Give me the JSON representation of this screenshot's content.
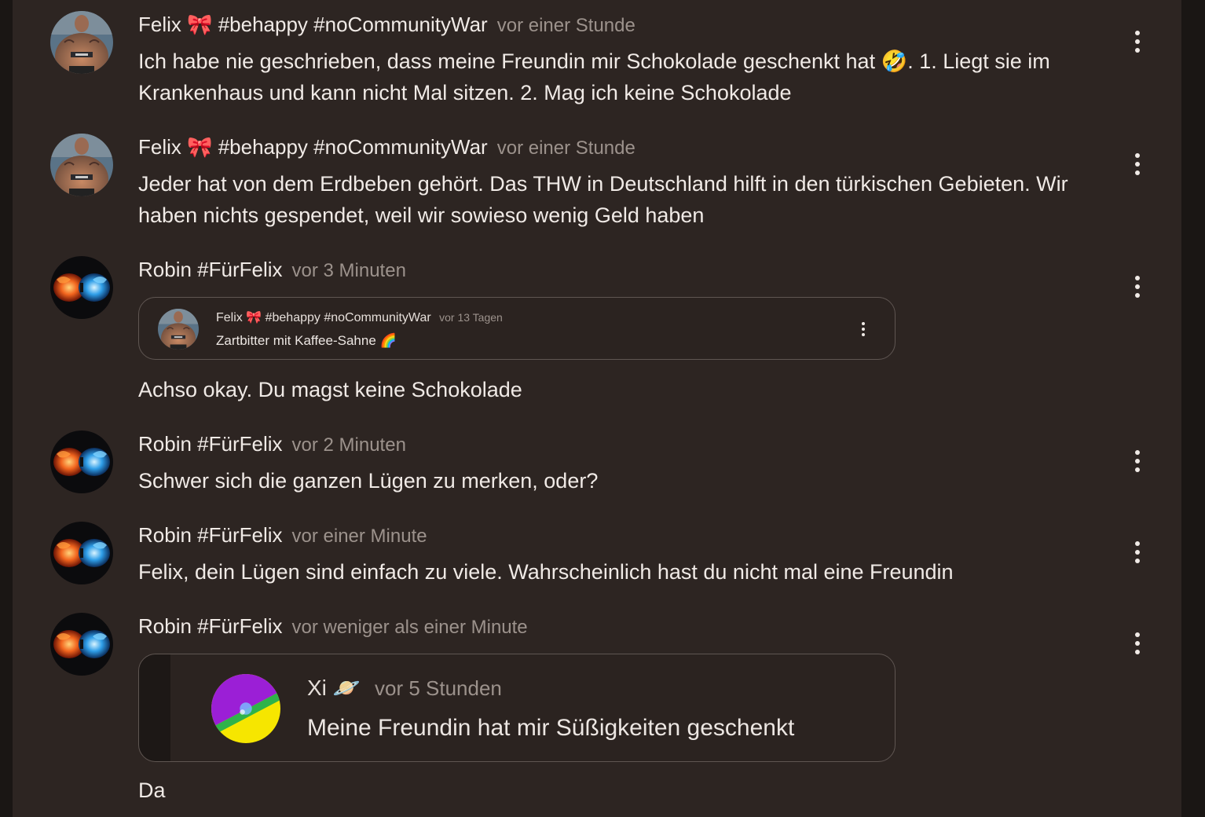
{
  "comments": [
    {
      "author": "Felix 🎀 #behappy #noCommunityWar",
      "time": "vor einer Stunde",
      "text_before": "Ich habe nie geschrieben, dass meine Freundin mir Schokolade geschenkt hat ",
      "text_emoji": "🤣",
      "text_after": ". 1. Liegt sie im Krankenhaus und kann nicht Mal sitzen. 2. Mag ich keine Schokolade",
      "avatar_icon": "bodybuilder-avatar-icon"
    },
    {
      "author": "Felix 🎀 #behappy #noCommunityWar",
      "time": "vor einer Stunde",
      "text": "Jeder hat von dem Erdbeben gehört. Das THW in Deutschland hilft in den türkischen Gebieten. Wir haben nichts gespendet, weil wir sowieso wenig Geld haben",
      "avatar_icon": "bodybuilder-avatar-icon"
    },
    {
      "author": "Robin #FürFelix",
      "time": "vor 3 Minuten",
      "quote": {
        "author": "Felix 🎀 #behappy #noCommunityWar",
        "time": "vor 13 Tagen",
        "text": "Zartbitter mit Kaffee-Sahne 🌈"
      },
      "text": "Achso okay. Du magst keine Schokolade",
      "avatar_icon": "fire-ice-fists-avatar-icon"
    },
    {
      "author": "Robin #FürFelix",
      "time": "vor 2 Minuten",
      "text": "Schwer sich die ganzen Lügen zu merken, oder?",
      "avatar_icon": "fire-ice-fists-avatar-icon"
    },
    {
      "author": "Robin #FürFelix",
      "time": "vor einer Minute",
      "text": "Felix, dein Lügen sind einfach zu viele. Wahrscheinlich hast du nicht mal eine Freundin",
      "avatar_icon": "fire-ice-fists-avatar-icon"
    },
    {
      "author": "Robin #FürFelix",
      "time": "vor weniger als einer Minute",
      "quote": {
        "author": "Xi 🪐",
        "time": "vor 5 Stunden",
        "text": "Meine Freundin hat mir Süßigkeiten geschenkt"
      },
      "text": "Da",
      "avatar_icon": "fire-ice-fists-avatar-icon"
    }
  ],
  "icons": {
    "menu": "more-vertical-icon"
  },
  "colors": {
    "background": "#2d2522",
    "text": "#f0eae6",
    "muted": "#9c928c",
    "border": "#5f5652"
  }
}
